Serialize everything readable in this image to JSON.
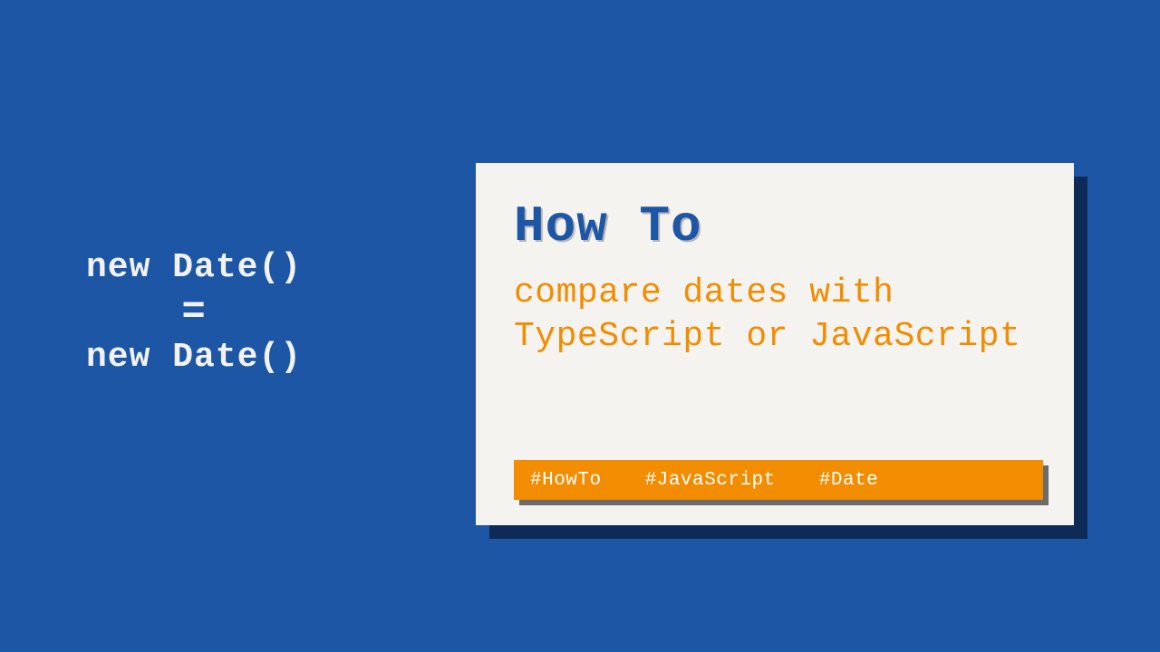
{
  "code": {
    "line1": "new Date()",
    "eq": "=",
    "line2": "new Date()"
  },
  "card": {
    "heading": "How To",
    "sub": "compare dates with TypeScript or JavaScript",
    "tags": [
      "#HowTo",
      "#JavaScript",
      "#Date"
    ]
  }
}
